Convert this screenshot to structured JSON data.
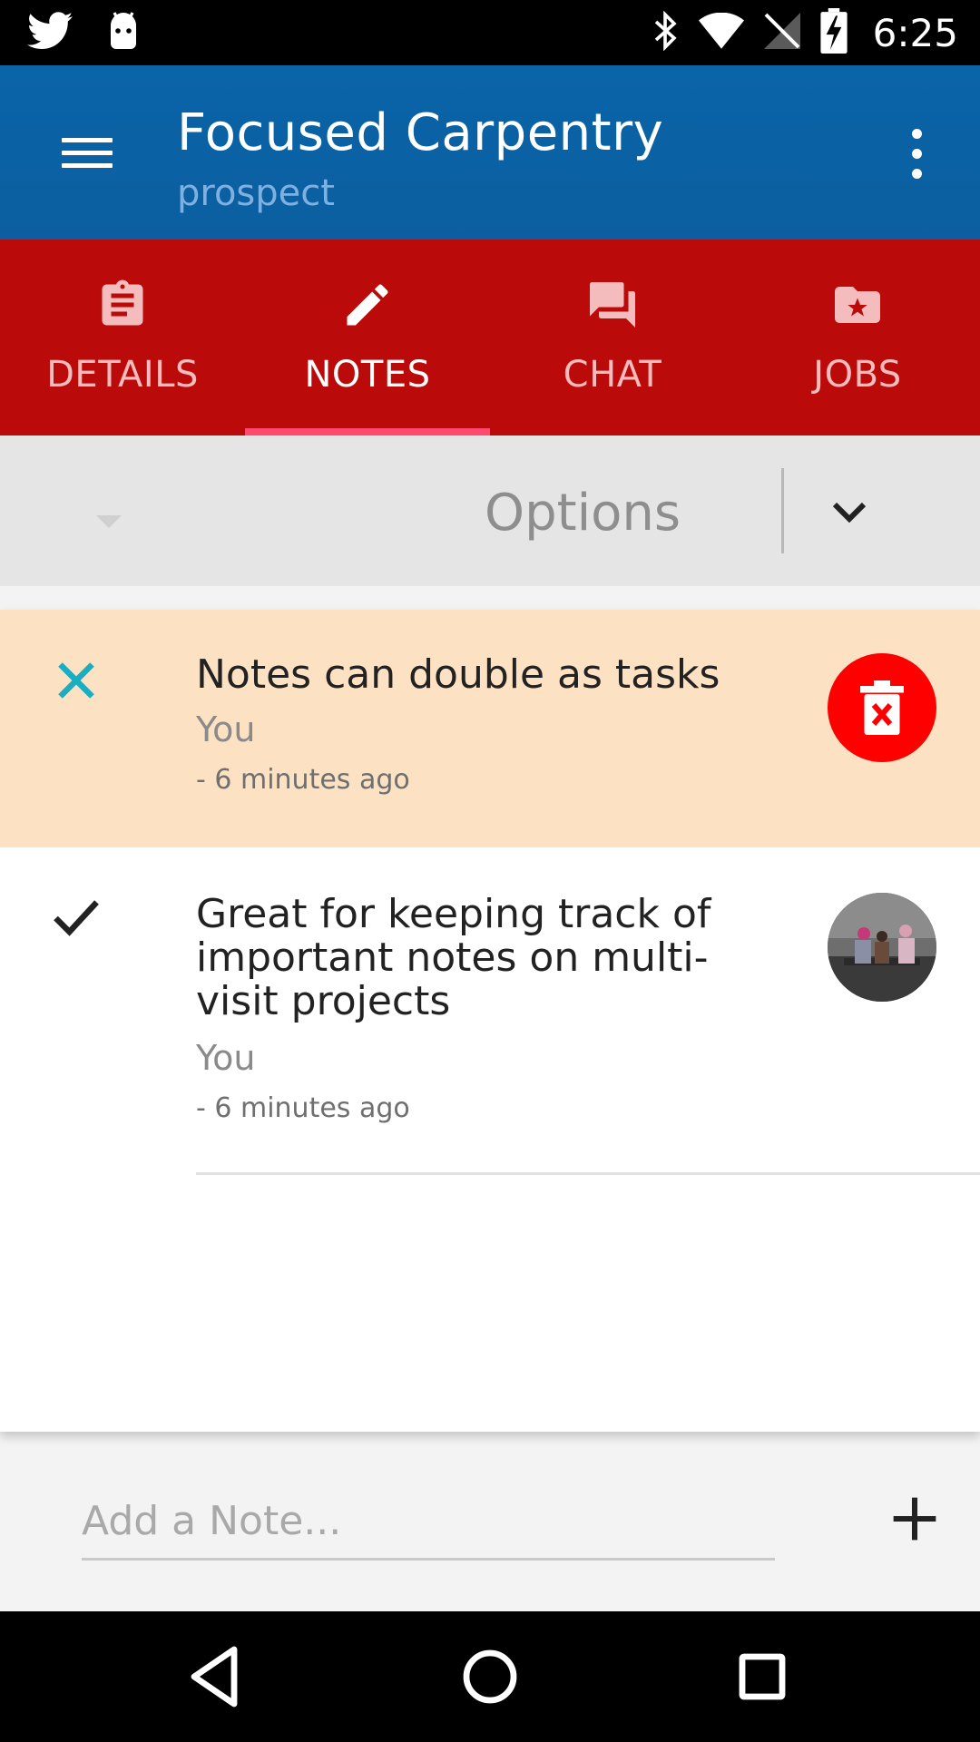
{
  "status_bar": {
    "time": "6:25",
    "left_icons": [
      "twitter-icon",
      "android-icon"
    ],
    "right_icons": [
      "bluetooth-icon",
      "wifi-icon",
      "no-sim-icon",
      "battery-charging-icon"
    ]
  },
  "app_bar": {
    "title": "Focused Carpentry",
    "subtitle": "prospect",
    "color": "#0a64a8"
  },
  "tabs": [
    {
      "label": "DETAILS",
      "icon": "clipboard-icon",
      "active": false
    },
    {
      "label": "NOTES",
      "icon": "pencil-icon",
      "active": true
    },
    {
      "label": "CHAT",
      "icon": "chat-icon",
      "active": false
    },
    {
      "label": "JOBS",
      "icon": "starred-folder-icon",
      "active": false
    }
  ],
  "tab_bar_color": "#bb0a0a",
  "options": {
    "label": "Options"
  },
  "notes": [
    {
      "title": "Notes can double as tasks",
      "author": "You",
      "time": "- 6 minutes ago",
      "status_icon": "close-icon",
      "action": "delete-icon",
      "highlight_color": "#fde1c3"
    },
    {
      "title": "Great for keeping track of important notes on multi-visit projects",
      "author": "You",
      "time": "- 6 minutes ago",
      "status_icon": "checkmark-icon",
      "action": "photo-thumbnail"
    }
  ],
  "add_note": {
    "placeholder": "Add a Note..."
  },
  "nav_bar": {
    "buttons": [
      "back-icon",
      "home-icon",
      "recents-icon"
    ]
  }
}
